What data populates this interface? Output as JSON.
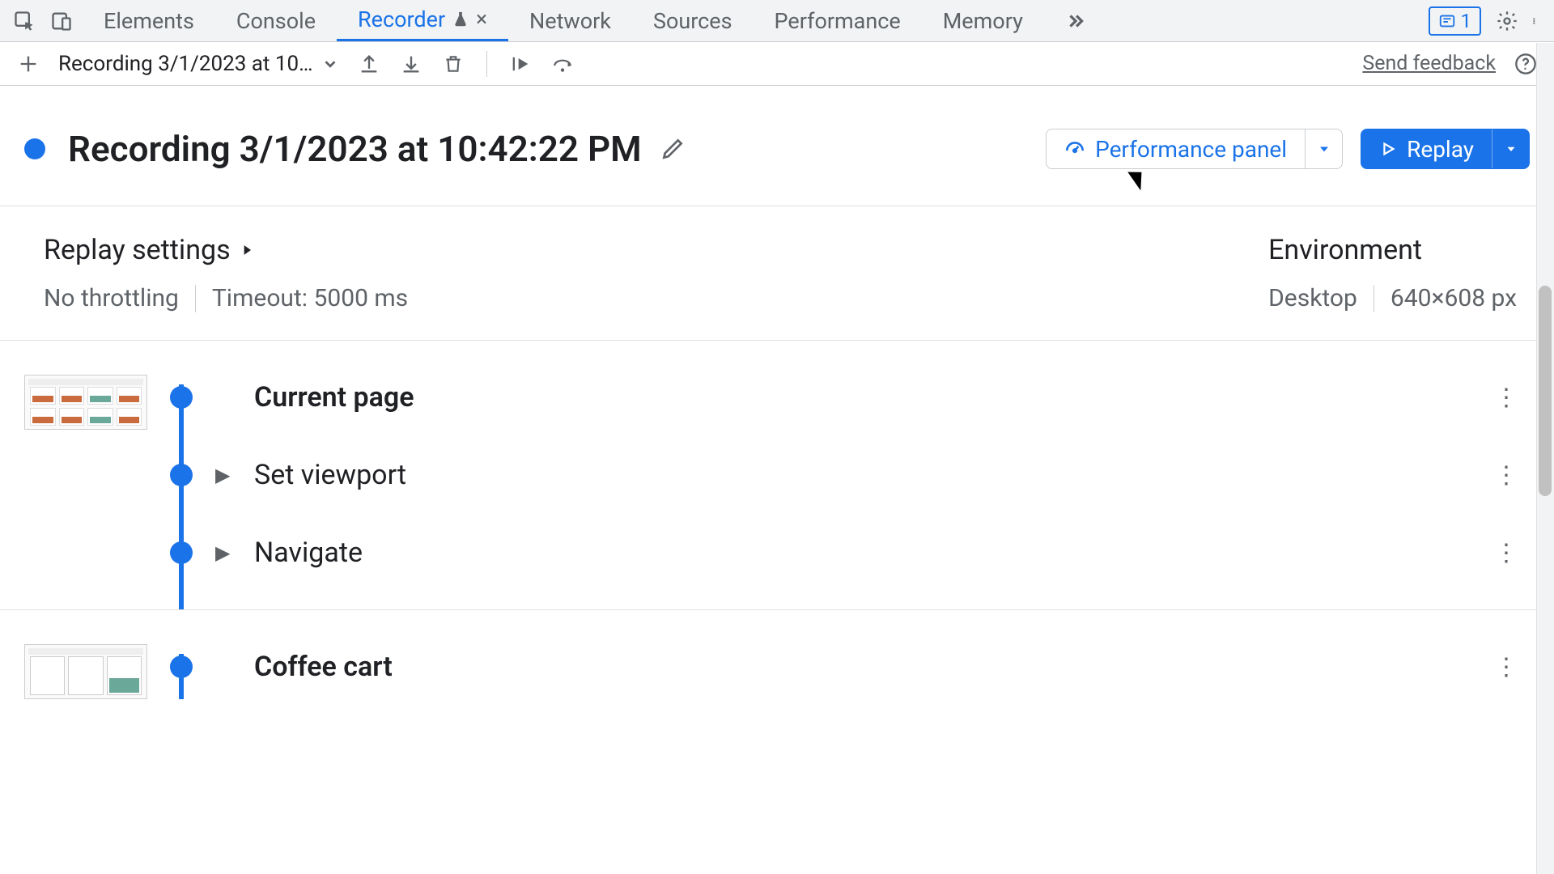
{
  "tabs": {
    "items": [
      "Elements",
      "Console",
      "Recorder",
      "Network",
      "Sources",
      "Performance",
      "Memory"
    ],
    "active_index": 2,
    "experimental_suffix": "⚗",
    "issues_count": "1"
  },
  "toolbar": {
    "recording_short": "Recording 3/1/2023 at 10…",
    "send_feedback": "Send feedback"
  },
  "header": {
    "title": "Recording 3/1/2023 at 10:42:22 PM",
    "perf_panel": "Performance panel",
    "replay": "Replay"
  },
  "settings": {
    "replay_heading": "Replay settings",
    "throttling": "No throttling",
    "timeout": "Timeout: 5000 ms",
    "env_heading": "Environment",
    "device": "Desktop",
    "dimensions": "640×608 px"
  },
  "steps": {
    "group1": {
      "s0": "Current page",
      "s1": "Set viewport",
      "s2": "Navigate"
    },
    "group2": {
      "s0": "Coffee cart"
    }
  }
}
